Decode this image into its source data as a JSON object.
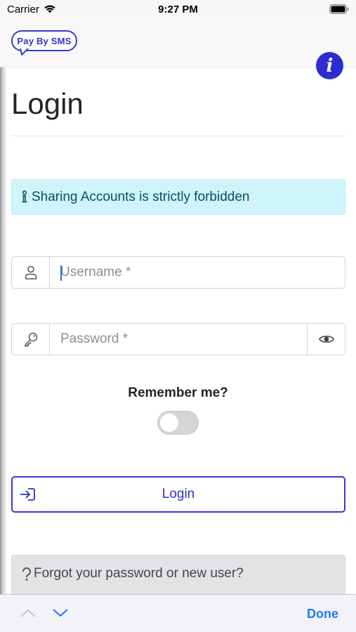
{
  "status_bar": {
    "carrier": "Carrier",
    "time": "9:27 PM"
  },
  "header": {
    "logo_text": "Pay By SMS",
    "info_icon_glyph": "i"
  },
  "page": {
    "title": "Login"
  },
  "alert": {
    "text": "Sharing Accounts is strictly forbidden",
    "icon": "info-icon"
  },
  "form": {
    "username": {
      "placeholder": "Username *",
      "value": "",
      "icon": "person-icon"
    },
    "password": {
      "placeholder": "Password *",
      "value": "",
      "icon": "key-icon",
      "toggle_icon": "eye-icon"
    },
    "remember_label": "Remember me?",
    "remember_on": false,
    "login_label": "Login",
    "login_icon": "sign-in-icon"
  },
  "forgot": {
    "text": "Forgot your password or new user?",
    "icon": "question-icon"
  },
  "keyboard_bar": {
    "done_label": "Done",
    "prev_icon": "chevron-up-icon",
    "next_icon": "chevron-down-icon"
  },
  "colors": {
    "brand": "#2d2dcf",
    "alert_bg": "#cff4fc",
    "alert_text": "#055160",
    "done_blue": "#1a7cf5"
  }
}
